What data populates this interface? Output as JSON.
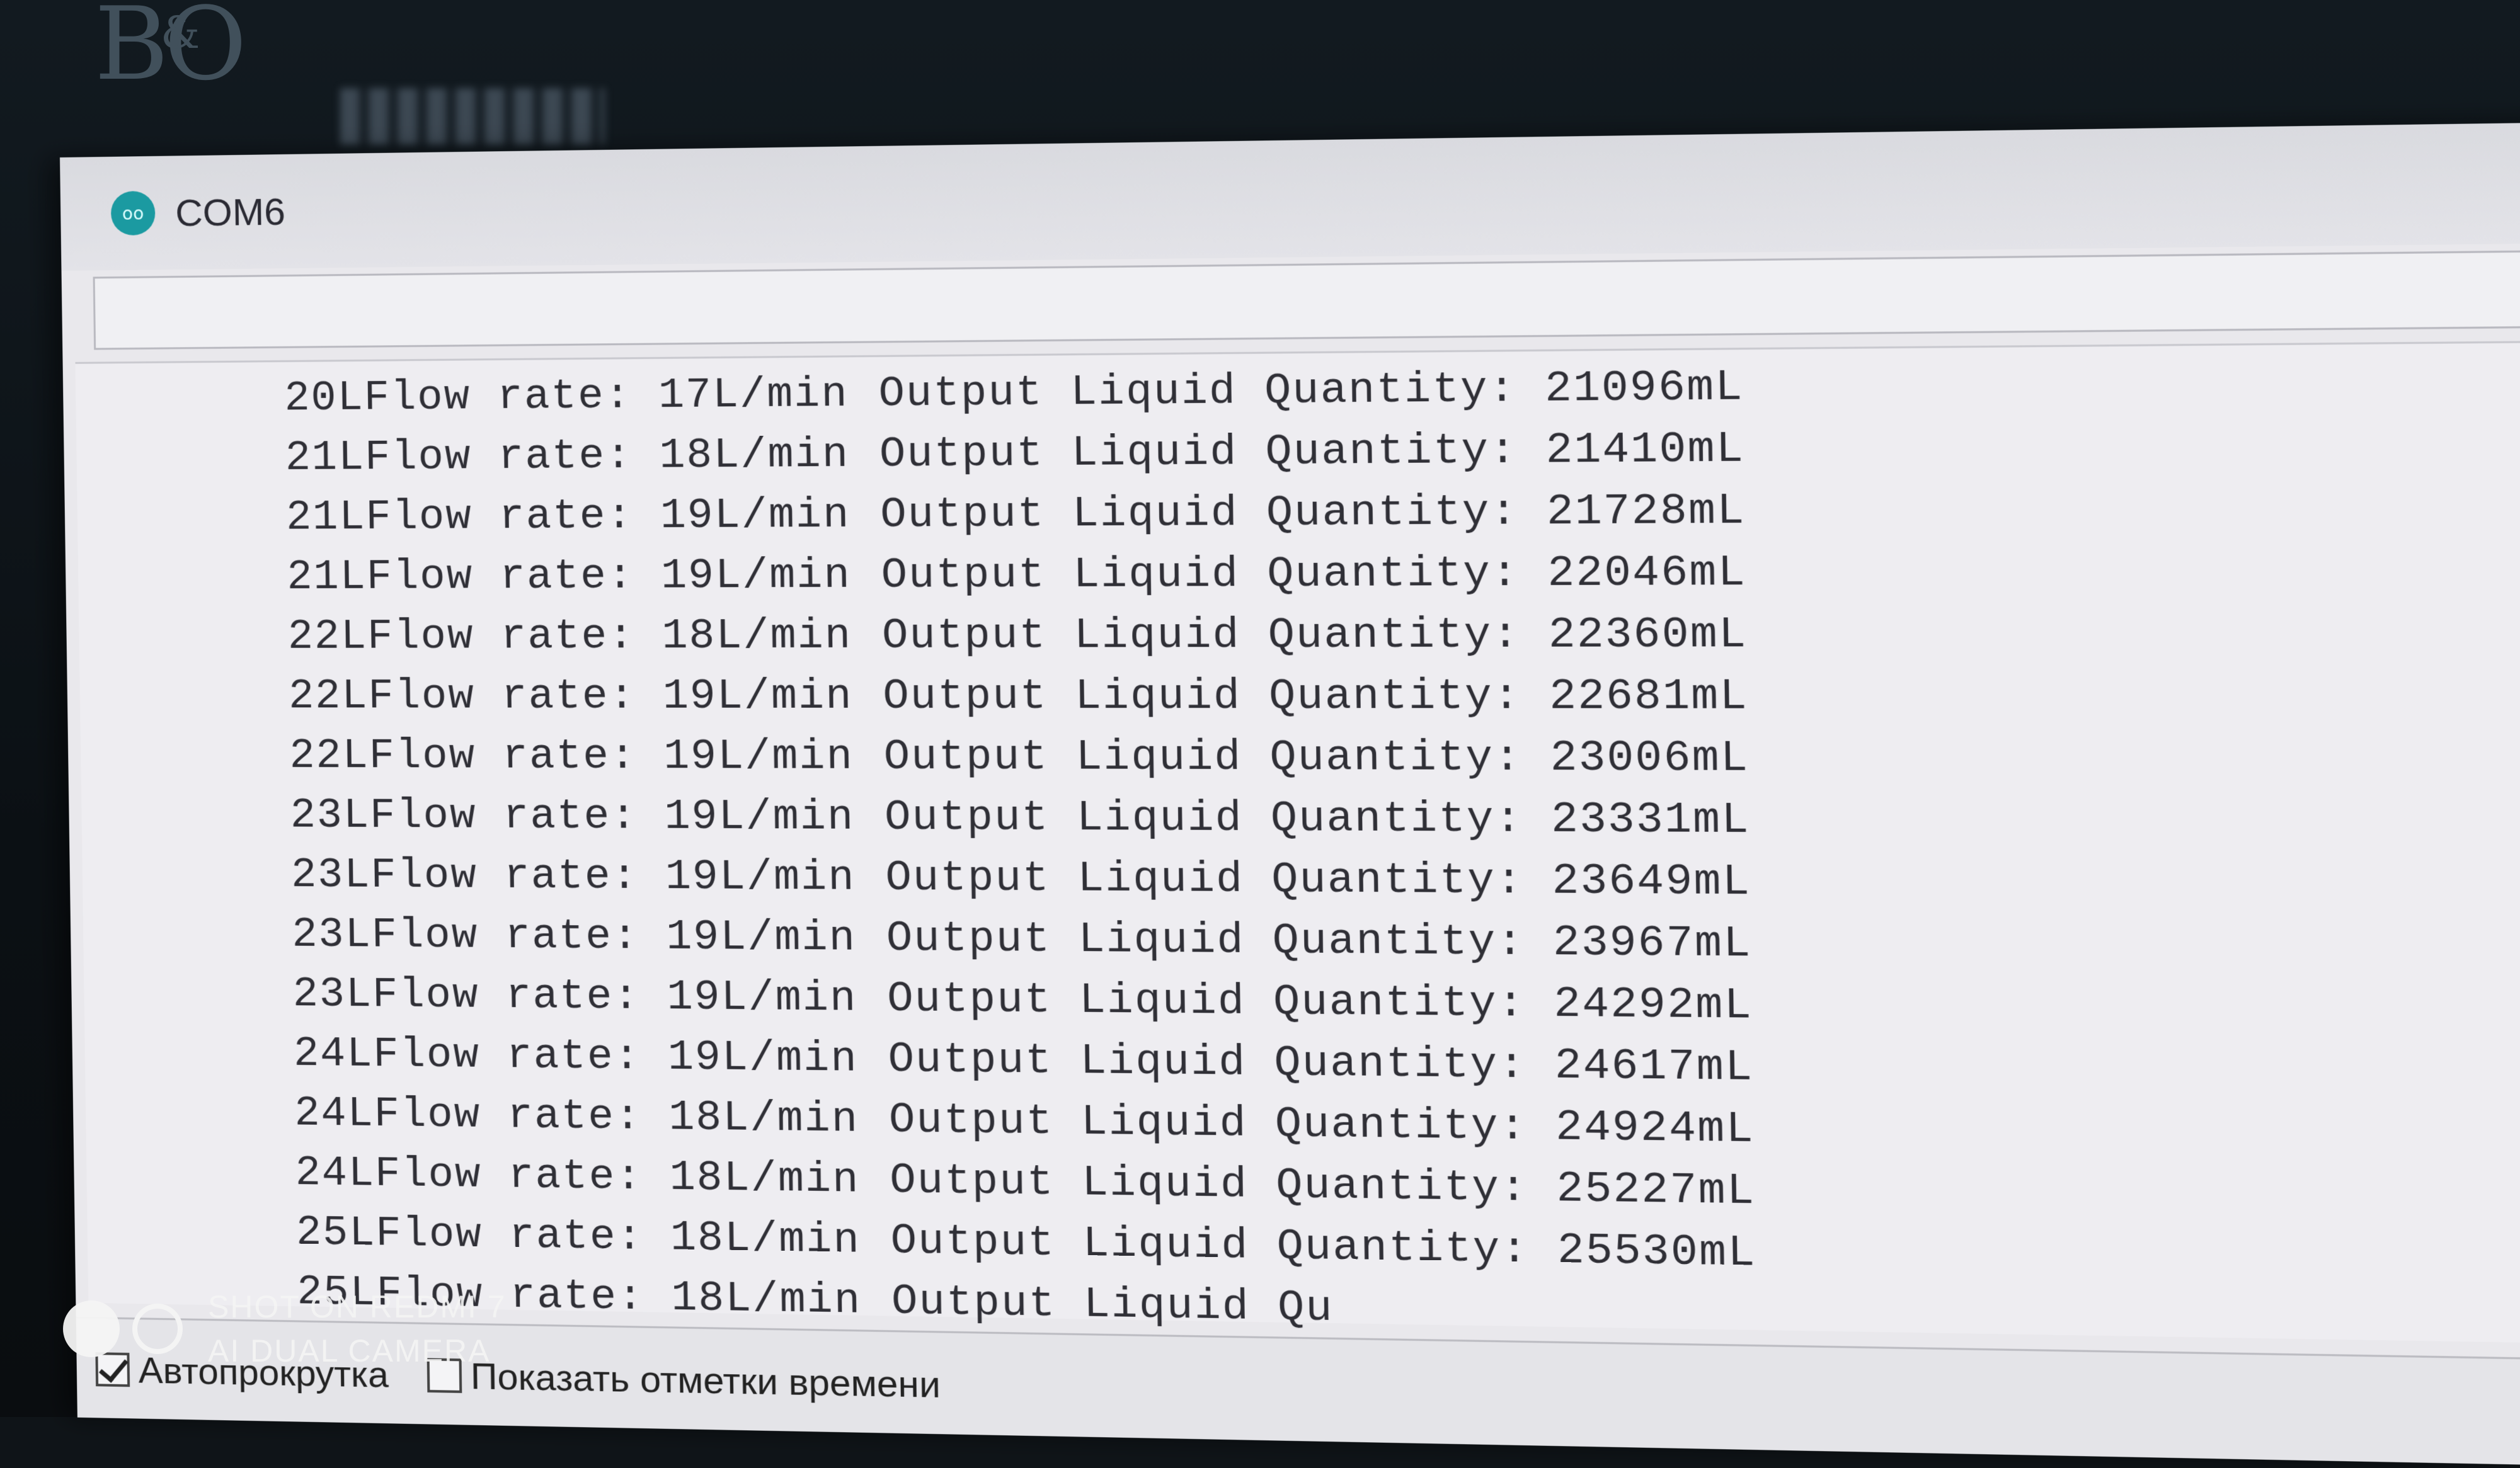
{
  "window": {
    "title": "COM6",
    "app_icon_label": "oo"
  },
  "serial_lines": [
    {
      "a": "20LFlow rate: 17L/min",
      "b": "Output Liquid Quantity: 21096mL"
    },
    {
      "a": "21LFlow rate: 18L/min",
      "b": "Output Liquid Quantity: 21410mL"
    },
    {
      "a": "21LFlow rate: 19L/min",
      "b": "Output Liquid Quantity: 21728mL"
    },
    {
      "a": "21LFlow rate: 19L/min",
      "b": "Output Liquid Quantity: 22046mL"
    },
    {
      "a": "22LFlow rate: 18L/min",
      "b": "Output Liquid Quantity: 22360mL"
    },
    {
      "a": "22LFlow rate: 19L/min",
      "b": "Output Liquid Quantity: 22681mL"
    },
    {
      "a": "22LFlow rate: 19L/min",
      "b": "Output Liquid Quantity: 23006mL"
    },
    {
      "a": "23LFlow rate: 19L/min",
      "b": "Output Liquid Quantity: 23331mL"
    },
    {
      "a": "23LFlow rate: 19L/min",
      "b": "Output Liquid Quantity: 23649mL"
    },
    {
      "a": "23LFlow rate: 19L/min",
      "b": "Output Liquid Quantity: 23967mL"
    },
    {
      "a": "23LFlow rate: 19L/min",
      "b": "Output Liquid Quantity: 24292mL"
    },
    {
      "a": "24LFlow rate: 19L/min",
      "b": "Output Liquid Quantity: 24617mL"
    },
    {
      "a": "24LFlow rate: 18L/min",
      "b": "Output Liquid Quantity: 24924mL"
    },
    {
      "a": "24LFlow rate: 18L/min",
      "b": "Output Liquid Quantity: 25227mL"
    },
    {
      "a": "25LFlow rate: 18L/min",
      "b": "Output Liquid Quantity: 25530mL"
    },
    {
      "a": "25LFlow rate: 18L/min",
      "b": "Output Liquid Qu"
    }
  ],
  "bottom_bar": {
    "autoscroll_label": "Автопрокрутка",
    "autoscroll_checked": true,
    "timestamps_label": "Показать отметки времени",
    "timestamps_checked": false
  },
  "watermark": {
    "line1": "SHOT ON REDMI 7",
    "line2": "AI DUAL CAMERA"
  }
}
